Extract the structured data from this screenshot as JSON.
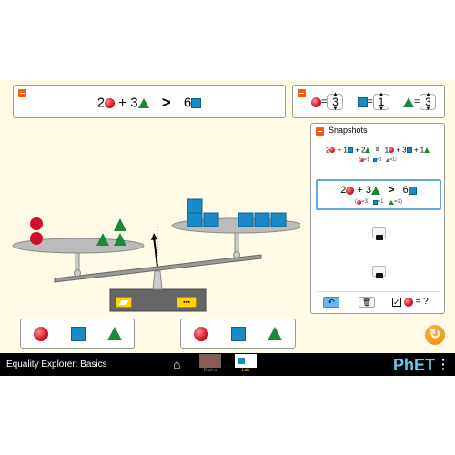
{
  "equation": {
    "left_coef_ball": "2",
    "plus": "+",
    "left_coef_tri": "3",
    "relation": ">",
    "right_coef_sq": "6"
  },
  "values": {
    "ball": "3",
    "square": "1",
    "triangle": "3",
    "equals": "="
  },
  "snapshots": {
    "title": "Snapshots",
    "items": [
      {
        "eq": {
          "a": "2",
          "b": "+ 1",
          "c": "+ 2",
          "rel": "=",
          "d": "1",
          "e": "+ 3",
          "f": "+ 1"
        },
        "vals": {
          "open": "(",
          "ball": "=1",
          "sq": "=1",
          "tri": "=1",
          "close": ")"
        }
      },
      {
        "eq": {
          "a": "2",
          "b": "+ 3",
          "rel": ">",
          "d": "6"
        },
        "vals": {
          "open": "(",
          "ball": "=3",
          "sq": "=1",
          "tri": "=3",
          "close": ")"
        }
      }
    ],
    "show_values_label": "= ?",
    "show_values_checked": true
  },
  "navbar": {
    "title": "Equality Explorer: Basics",
    "screens": [
      {
        "label": "Basics"
      },
      {
        "label": "Lab"
      }
    ],
    "brand": "PhET"
  },
  "colors": {
    "background": "#fffbe6",
    "ball": "#d0102a",
    "square": "#1a8bc8",
    "triangle": "#1a8a3a",
    "accent": "#f25c0a",
    "selected_screen": "#ffd400"
  },
  "icons": [
    "minus-icon",
    "camera-icon",
    "undo-icon",
    "trash-icon",
    "refresh-icon",
    "home-icon",
    "eraser-icon",
    "organize-icon",
    "menu-icon"
  ]
}
